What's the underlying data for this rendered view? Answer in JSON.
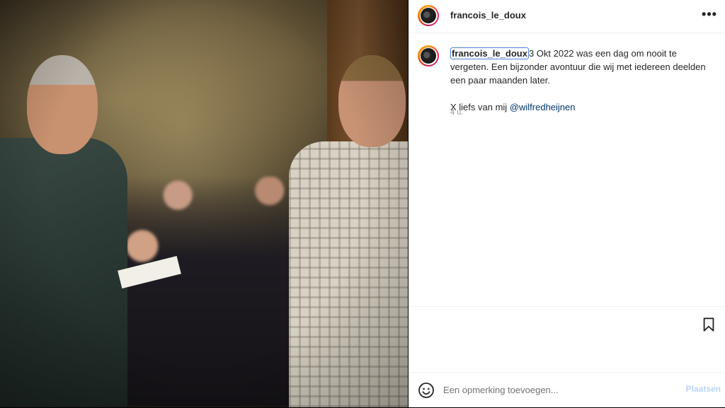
{
  "post": {
    "username": "francois_le_doux",
    "more_label": "•••",
    "caption": {
      "username": "francois_le_doux",
      "text_part1": "3 Okt 2022 was een dag om nooit te vergeten. Een bijzonder avontuur die wij met iedereen deelden een paar maanden later.",
      "text_part2": "X liefs van mij ",
      "mention": "@wilfredheijnen"
    },
    "time_ago": "4 u."
  },
  "comment": {
    "placeholder": "Een opmerking toevoegen...",
    "post_label": "Plaatsen"
  },
  "icons": {
    "more": "more-options-icon",
    "bookmark": "bookmark-icon",
    "emoji": "emoji-icon"
  },
  "colors": {
    "mention": "#00376b",
    "post_button_disabled": "#b7d5f7",
    "highlight_box": "#4a7fd6"
  }
}
